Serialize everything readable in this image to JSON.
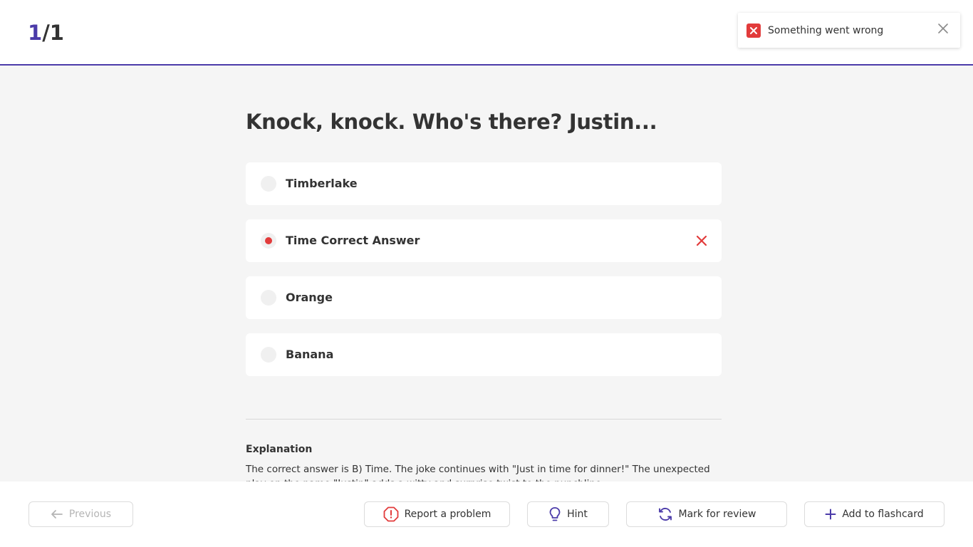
{
  "header": {
    "current": "1",
    "total": "/1"
  },
  "toast": {
    "message": "Something went wrong",
    "icon": "error-icon",
    "color": "#e23b3b"
  },
  "question": {
    "text": "Knock, knock. Who's there? Justin..."
  },
  "options": [
    {
      "label": "Timberlake",
      "selected": false
    },
    {
      "label": "Time Correct Answer",
      "selected": true,
      "status": "incorrect"
    },
    {
      "label": "Orange",
      "selected": false
    },
    {
      "label": "Banana",
      "selected": false
    }
  ],
  "explanation": {
    "title": "Explanation",
    "text": "The correct answer is B) Time. The joke continues with \"Just in time for dinner!\" The unexpected play on the name \"Justin\" adds a witty and surprise twist to the punchline."
  },
  "footer": {
    "previous": "Previous",
    "report": "Report a problem",
    "hint": "Hint",
    "review": "Mark for review",
    "flashcard": "Add to flashcard"
  },
  "colors": {
    "accent": "#4b3ba9",
    "error": "#e23b3b"
  }
}
